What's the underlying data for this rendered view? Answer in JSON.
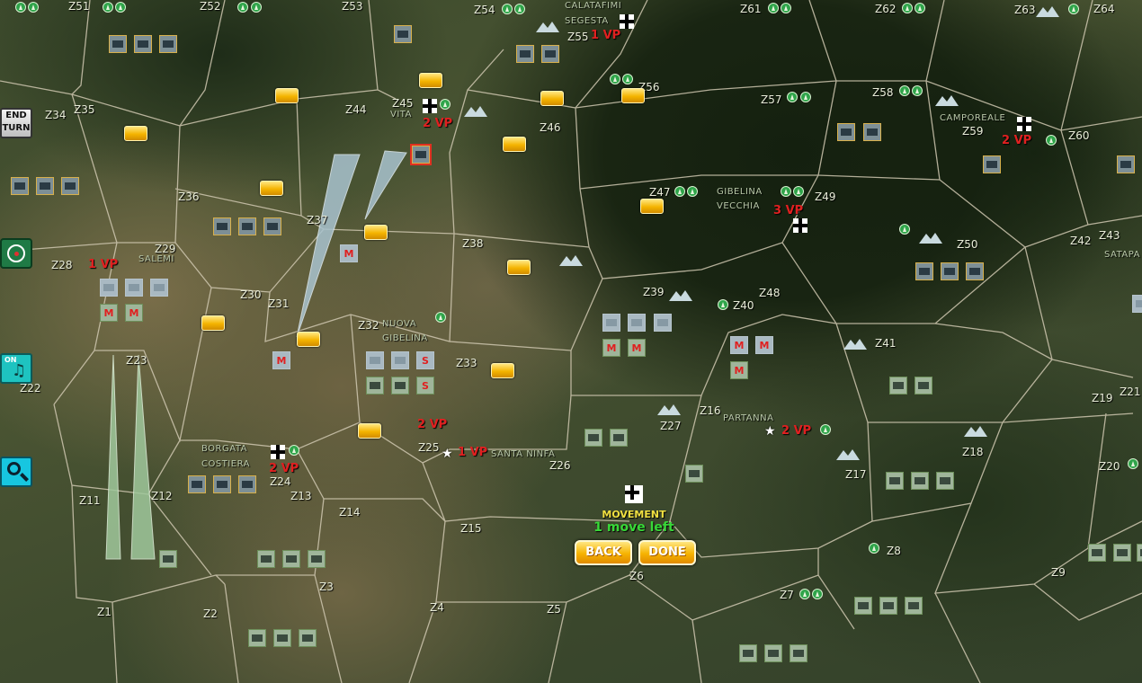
{
  "map": {
    "zones": [
      "Z51",
      "Z52",
      "Z53",
      "Z54",
      "Z55",
      "Z61",
      "Z62",
      "Z63",
      "Z64",
      "Z34",
      "Z35",
      "Z44",
      "Z45",
      "Z46",
      "Z56",
      "Z57",
      "Z58",
      "Z59",
      "Z60",
      "Z36",
      "Z37",
      "Z38",
      "Z47",
      "Z49",
      "Z50",
      "Z42",
      "Z43",
      "Z28",
      "Z29",
      "Z39",
      "Z40",
      "Z48",
      "Z30",
      "Z31",
      "Z32",
      "Z33",
      "Z41",
      "Z23",
      "Z22",
      "Z27",
      "Z16",
      "Z19",
      "Z21",
      "Z25",
      "Z26",
      "Z24",
      "Z13",
      "Z14",
      "Z15",
      "Z17",
      "Z18",
      "Z20",
      "Z11",
      "Z12",
      "Z8",
      "Z9",
      "Z3",
      "Z6",
      "Z4",
      "Z5",
      "Z1",
      "Z2",
      "Z7"
    ],
    "towns": [
      "CALATAFIMI",
      "SEGESTA",
      "VITA",
      "CAMPOREALE",
      "GIBELINA",
      "VECCHIA",
      "SALEMI",
      "SATAPA",
      "NUOVA",
      "GIBELINA",
      "BORGATA",
      "COSTIERA",
      "SANTA NINFA",
      "PARTANNA"
    ],
    "victory_points": [
      "1 VP",
      "2 VP",
      "2 VP",
      "3 VP",
      "1 VP",
      "2 VP",
      "1 VP",
      "2 VP",
      "2 VP"
    ],
    "unit_letters": [
      "M",
      "M",
      "M",
      "M",
      "M",
      "M",
      "M",
      "M",
      "M",
      "S",
      "S"
    ]
  },
  "sidebar": {
    "end_turn_line1": "END",
    "end_turn_line2": "TURN",
    "music_on": "ON",
    "target_icon": "target-icon",
    "search_icon": "magnifier-icon"
  },
  "phase_panel": {
    "phase": "MOVEMENT",
    "moves_left": "1 move left",
    "back_label": "BACK",
    "done_label": "DONE"
  },
  "colors": {
    "victory_points": "#e02020",
    "moves_text": "#38d838",
    "phase_text": "#f0e040",
    "button_gold": "#f6b300"
  }
}
